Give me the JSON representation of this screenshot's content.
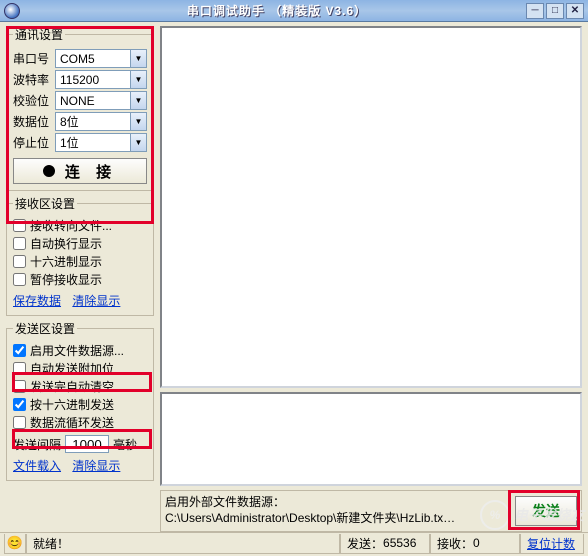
{
  "title": "串口调试助手 （精装版 V3.6）",
  "comm": {
    "legend": "通讯设置",
    "port_label": "串口号",
    "port_value": "COM5",
    "baud_label": "波特率",
    "baud_value": "115200",
    "parity_label": "校验位",
    "parity_value": "NONE",
    "databits_label": "数据位",
    "databits_value": "8位",
    "stopbits_label": "停止位",
    "stopbits_value": "1位",
    "connect_label": "连 接"
  },
  "recv": {
    "legend": "接收区设置",
    "to_file": "接收转向文件...",
    "auto_wrap": "自动换行显示",
    "hex_show": "十六进制显示",
    "pause": "暂停接收显示",
    "save": "保存数据",
    "clear": "清除显示"
  },
  "send": {
    "legend": "发送区设置",
    "use_file": "启用文件数据源...",
    "auto_extra": "自动发送附加位",
    "clear_after": "发送完自动清空",
    "hex_send": "按十六进制发送",
    "loop_send": "数据流循环发送",
    "interval_label": "发送间隔",
    "interval_value": "1000",
    "interval_unit": "毫秒",
    "load_file": "文件载入",
    "clear": "清除显示"
  },
  "ext_source": {
    "label": "启用外部文件数据源：",
    "path": "C:\\Users\\Administrator\\Desktop\\新建文件夹\\HzLib.tx…",
    "send_btn": "发送"
  },
  "status": {
    "ready": "就绪！",
    "send_count_label": "发送：",
    "send_count_value": "65536",
    "recv_count_label": "接收：",
    "recv_count_value": "0",
    "reset": "复位计数"
  },
  "watermark": "电子发烧友"
}
